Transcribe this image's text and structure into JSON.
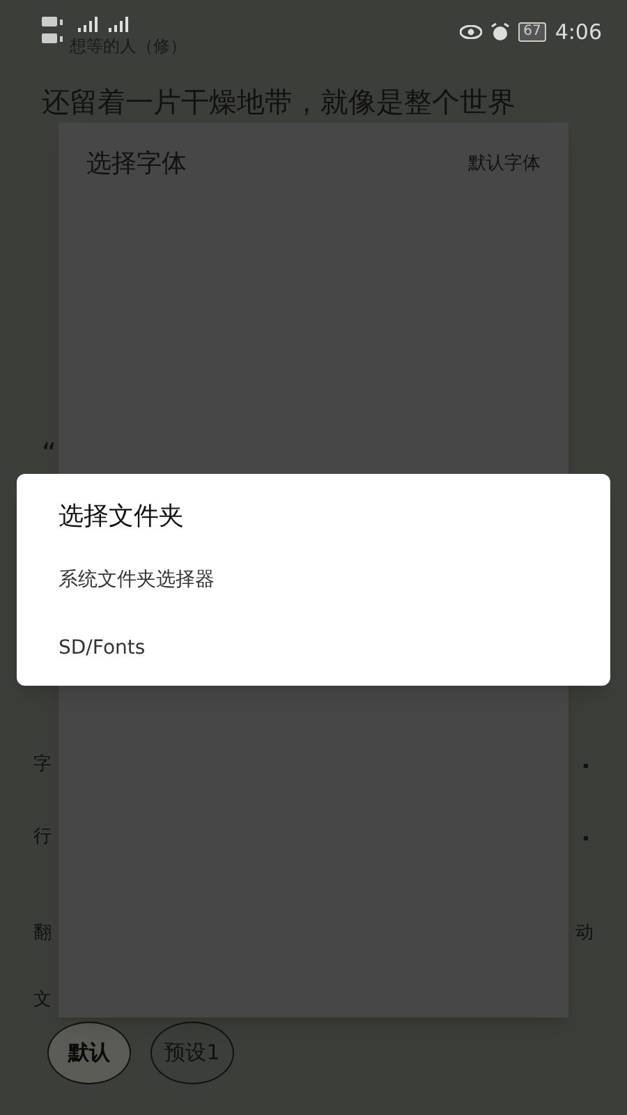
{
  "status_bar": {
    "battery": "67",
    "time": "4:06"
  },
  "book_title": "想等的人（修）",
  "reader_rows": [
    {
      "left": "还留着一片干燥地带，就像是整个世界"
    },
    {
      "left": "“"
    }
  ],
  "settings": [
    {
      "kind": "slider",
      "label": "字"
    },
    {
      "kind": "slider",
      "label": "行"
    },
    {
      "kind": "option",
      "label": "翻",
      "value": "动"
    },
    {
      "kind": "heading",
      "label": "文"
    }
  ],
  "presets": [
    {
      "label": "默认",
      "selected": true
    },
    {
      "label": "预设1",
      "selected": false
    }
  ],
  "font_dialog": {
    "title": "选择字体",
    "action": "默认字体"
  },
  "folder_dialog": {
    "title": "选择文件夹",
    "items": [
      "系统文件夹选择器",
      "SD/Fonts"
    ]
  }
}
